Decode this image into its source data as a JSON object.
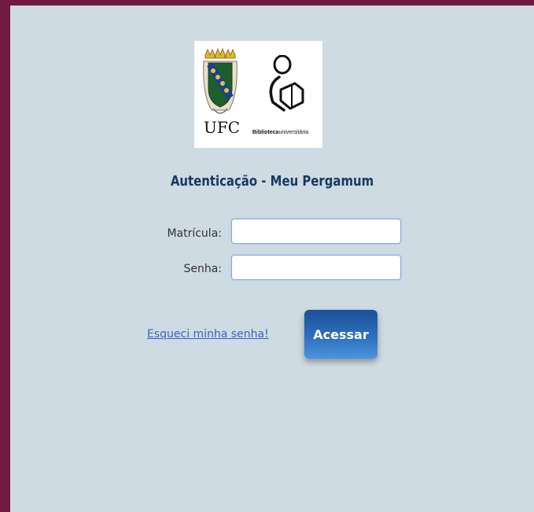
{
  "logos": {
    "ufc_text": "UFC",
    "library_bold": "Biblioteca",
    "library_rest": "universitária"
  },
  "title": "Autenticação - Meu Pergamum",
  "form": {
    "matricula_label": "Matrícula:",
    "matricula_value": "",
    "senha_label": "Senha:",
    "senha_value": ""
  },
  "forgot_link": "Esqueci minha senha!",
  "submit_label": "Acessar",
  "colors": {
    "frame": "#701a43",
    "panel": "#cedbe2",
    "title": "#173a62",
    "link": "#3c63c8",
    "button": "#2e6fbd"
  }
}
